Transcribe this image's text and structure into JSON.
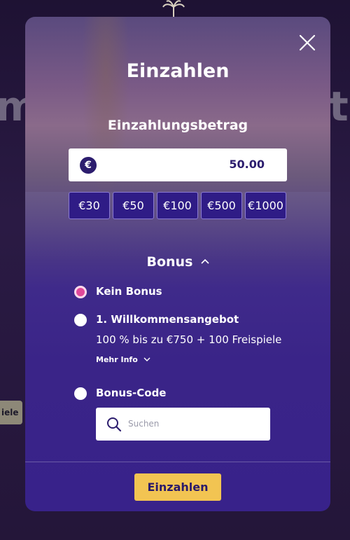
{
  "background": {
    "left_text": "m",
    "right_text": "t",
    "chip_text": "iele"
  },
  "modal": {
    "title": "Einzahlen",
    "amount_label": "Einzahlungsbetrag",
    "currency_symbol": "€",
    "amount_value": "50.00",
    "presets": [
      "€30",
      "€50",
      "€100",
      "€500",
      "€1000"
    ],
    "bonus_heading": "Bonus",
    "options": [
      {
        "label": "Kein Bonus",
        "selected": true
      },
      {
        "label": "1. Willkommensangebot",
        "selected": false
      },
      {
        "label": "Bonus-Code",
        "selected": false
      }
    ],
    "offer_description": "100 % bis zu €750 + 100 Freispiele",
    "more_info": "Mehr Info",
    "search_placeholder": "Suchen",
    "submit_label": "Einzahlen"
  },
  "colors": {
    "accent_button": "#f2c452",
    "selected_radio": "#e0489a",
    "modal_bottom": "#38228a"
  },
  "icons": {
    "close": "close-icon",
    "euro": "euro-icon",
    "chevron_up": "chevron-up-icon",
    "chevron_down": "chevron-down-icon",
    "search": "search-icon",
    "logo": "palm-logo-icon"
  }
}
